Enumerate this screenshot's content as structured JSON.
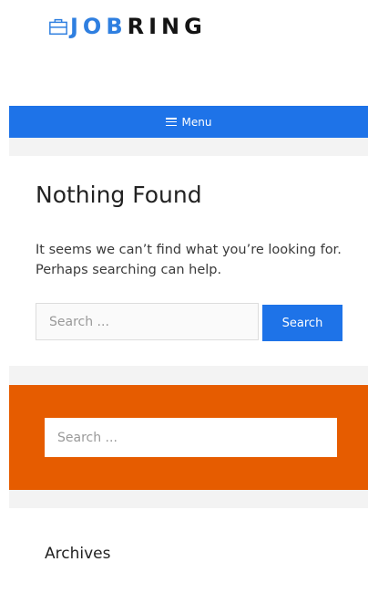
{
  "logo": {
    "icon": "briefcase-icon",
    "text_part1": "JOB",
    "text_part2": "RING",
    "color_primary": "#2f7fe0",
    "color_dark": "#141414"
  },
  "menu": {
    "label": "Menu",
    "icon": "hamburger-icon",
    "bg_color": "#1e73e8"
  },
  "main": {
    "title": "Nothing Found",
    "message": "It seems we can’t find what you’re looking for. Perhaps searching can help.",
    "search": {
      "placeholder": "Search ...",
      "button_label": "Search"
    }
  },
  "sidebar": {
    "search_widget": {
      "placeholder": "Search ...",
      "bg_color": "#e65c00"
    },
    "archives": {
      "title": "Archives"
    }
  }
}
